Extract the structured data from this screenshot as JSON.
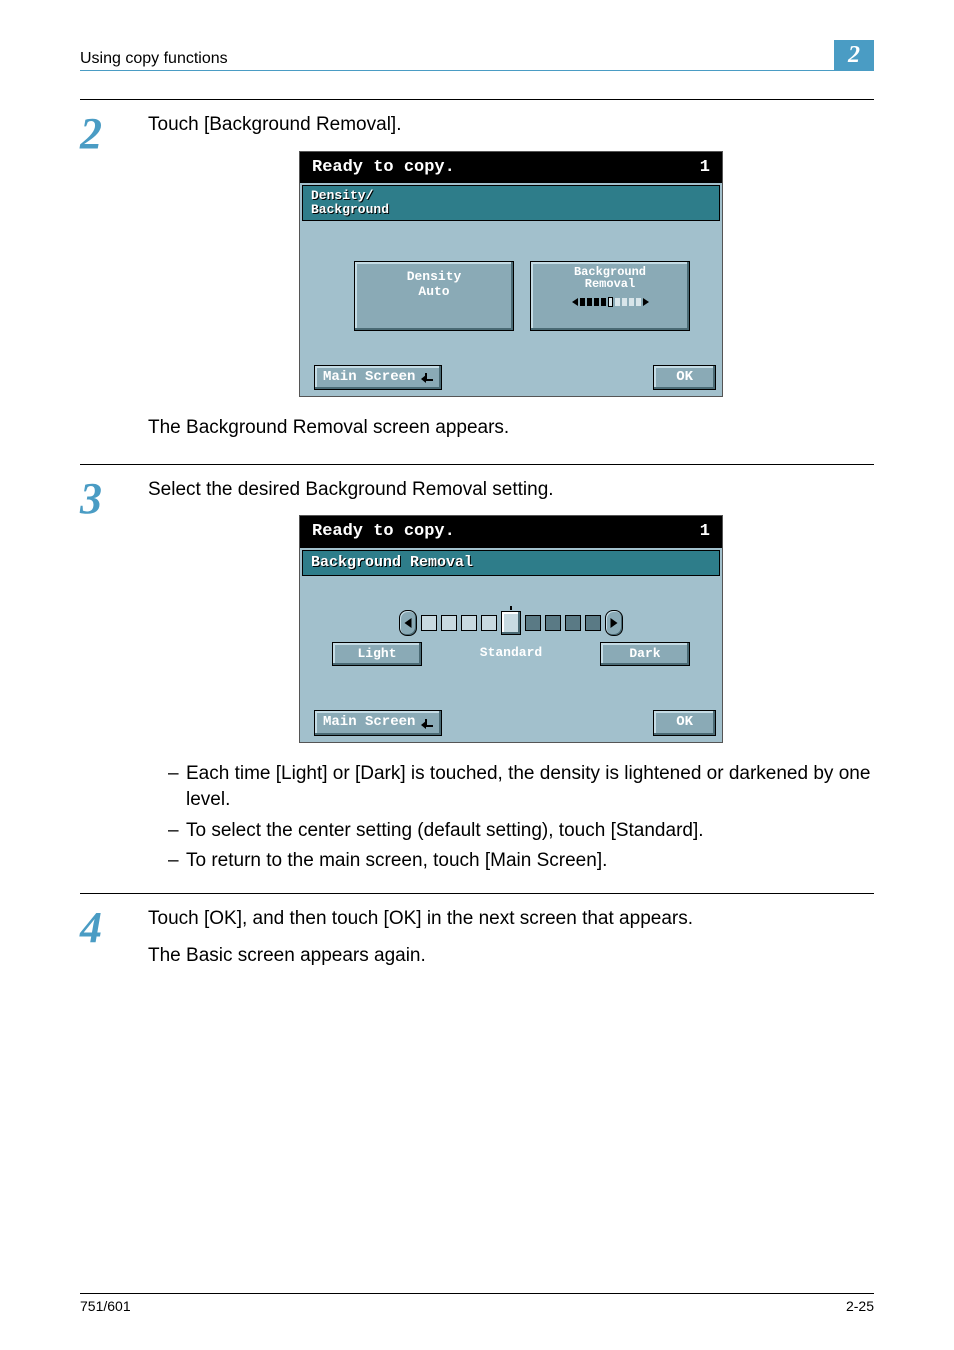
{
  "header": {
    "section_title": "Using copy functions",
    "chapter_number": "2"
  },
  "step2": {
    "number": "2",
    "instruction": "Touch [Background Removal].",
    "result": "The Background Removal screen appears.",
    "screen": {
      "status_text": "Ready to copy.",
      "status_count": "1",
      "tab_label": "Density/\nBackground",
      "density_btn_label": "Density",
      "density_btn_value": "Auto",
      "bgremoval_btn_label": "Background\nRemoval",
      "main_screen_label": "Main Screen",
      "ok_label": "OK"
    }
  },
  "step3": {
    "number": "3",
    "instruction": "Select the desired Background Removal setting.",
    "screen": {
      "status_text": "Ready to copy.",
      "status_count": "1",
      "tab_label": "Background Removal",
      "light_label": "Light",
      "standard_label": "Standard",
      "dark_label": "Dark",
      "main_screen_label": "Main Screen",
      "ok_label": "OK"
    },
    "notes": [
      "Each time [Light] or [Dark] is touched, the density is lightened or darkened by one level.",
      "To select the center setting (default setting), touch [Standard].",
      "To return to the main screen, touch [Main Screen]."
    ]
  },
  "step4": {
    "number": "4",
    "instruction": "Touch [OK], and then touch [OK] in the next screen that appears.",
    "result": "The Basic screen appears again."
  },
  "footer": {
    "model": "751/601",
    "page_number": "2-25"
  }
}
